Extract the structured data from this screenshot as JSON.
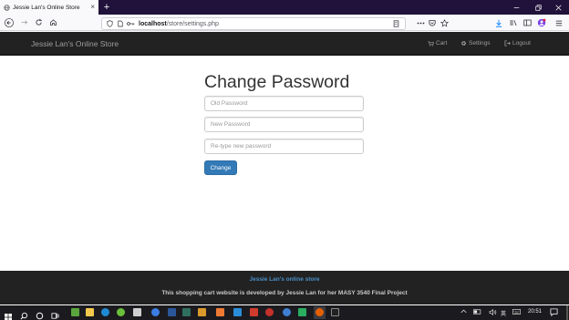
{
  "browser": {
    "tab_title": "Jessie Lan's Online Store",
    "new_tab": "+",
    "url_host": "localhost",
    "url_path": "/store/settings.php"
  },
  "site": {
    "brand": "Jessie Lan's Online Store",
    "nav": {
      "cart": "Cart",
      "settings": "Settings",
      "logout": "Logout"
    }
  },
  "form": {
    "title": "Change Password",
    "old_password_placeholder": "Old Password",
    "new_password_placeholder": "New Password",
    "retype_placeholder": "Re-type new password",
    "submit_label": "Change"
  },
  "footer": {
    "title": "Jessie Lan's online store",
    "description": "This shopping cart website is developed by Jessie Lan for her MASY 3540 Final Project"
  },
  "taskbar": {
    "ime": "英",
    "clock": "20:51"
  },
  "colors": {
    "navbar_bg": "#222222",
    "primary_button": "#337ab7",
    "footer_link": "#4a90c8"
  }
}
